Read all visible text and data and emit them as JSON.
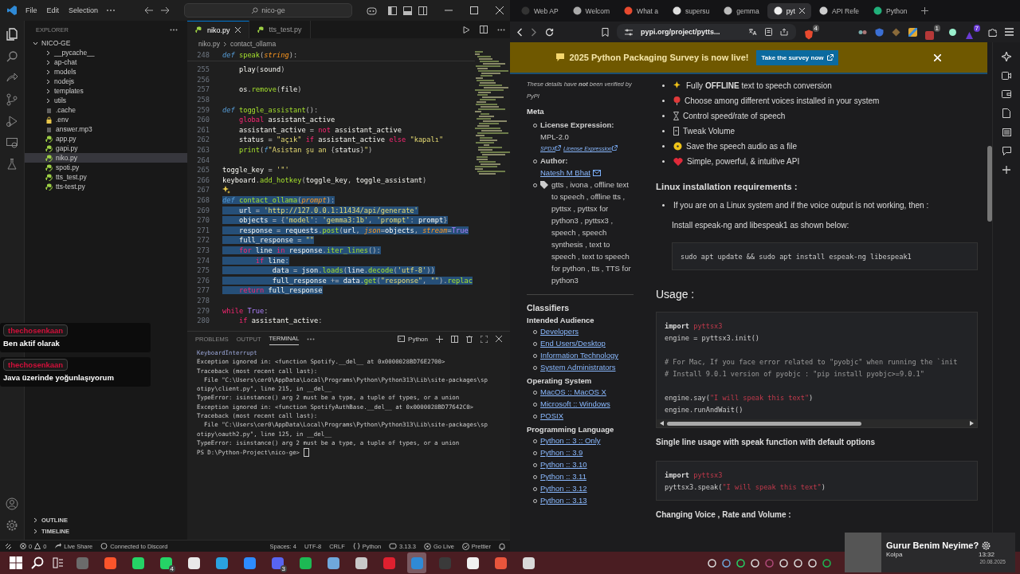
{
  "vscode": {
    "menus": [
      "File",
      "Edit",
      "Selection"
    ],
    "search": "nico-ge",
    "explorer": {
      "title": "EXPLORER",
      "root": {
        "label": "NICO-GE",
        "expanded": true,
        "children": [
          {
            "label": "__pycache__",
            "kind": "folder",
            "expanded": false,
            "selected": false
          },
          {
            "label": "ap-chat",
            "kind": "folder",
            "expanded": false,
            "selected": false
          },
          {
            "label": "models",
            "kind": "folder",
            "expanded": false,
            "selected": false
          },
          {
            "label": "nodejs",
            "kind": "folder",
            "expanded": false,
            "selected": false
          },
          {
            "label": "templates",
            "kind": "folder",
            "expanded": false,
            "selected": false
          },
          {
            "label": "utils",
            "kind": "folder",
            "expanded": false,
            "selected": false
          },
          {
            "label": ".cache",
            "kind": "text",
            "selected": false
          },
          {
            "label": ".env",
            "kind": "env",
            "selected": false
          },
          {
            "label": "answer.mp3",
            "kind": "text",
            "selected": false
          },
          {
            "label": "app.py",
            "kind": "python",
            "selected": false
          },
          {
            "label": "gapi.py",
            "kind": "python",
            "selected": false
          },
          {
            "label": "niko.py",
            "kind": "python",
            "selected": true
          },
          {
            "label": "spoti.py",
            "kind": "python",
            "selected": false
          },
          {
            "label": "tts_test.py",
            "kind": "python",
            "selected": false
          },
          {
            "label": "tts-test.py",
            "kind": "python",
            "selected": false
          }
        ]
      },
      "sections": [
        {
          "label": "OUTLINE",
          "expanded": false
        },
        {
          "label": "TIMELINE",
          "expanded": false
        }
      ]
    },
    "tabs": [
      {
        "label": "niko.py",
        "selected": true
      },
      {
        "label": "tts_test.py",
        "selected": false
      }
    ],
    "breadcrumb": [
      "niko.py",
      "contact_ollama"
    ],
    "sticky": {
      "n": "248",
      "parts": [
        {
          "kind": "k",
          "text": "def "
        },
        {
          "kind": "f",
          "text": "speak"
        },
        {
          "kind": "o",
          "text": "("
        },
        {
          "kind": "p",
          "text": "string"
        },
        {
          "kind": "o",
          "text": "):"
        }
      ]
    },
    "lines": [
      {
        "n": "255",
        "kind": "code",
        "selected": false,
        "parts": [
          {
            "kind": "v",
            "text": "    play"
          },
          {
            "kind": "o",
            "text": "("
          },
          {
            "kind": "v",
            "text": "sound"
          },
          {
            "kind": "o",
            "text": ")"
          }
        ]
      },
      {
        "n": "256",
        "kind": "blank",
        "selected": false
      },
      {
        "n": "257",
        "kind": "code",
        "selected": false,
        "parts": [
          {
            "kind": "v",
            "text": "    os"
          },
          {
            "kind": "o",
            "text": "."
          },
          {
            "kind": "f",
            "text": "remove"
          },
          {
            "kind": "o",
            "text": "("
          },
          {
            "kind": "v",
            "text": "file"
          },
          {
            "kind": "o",
            "text": ")"
          }
        ]
      },
      {
        "n": "258",
        "kind": "blank",
        "selected": false
      },
      {
        "n": "259",
        "kind": "code",
        "selected": false,
        "parts": [
          {
            "kind": "k",
            "text": "def "
          },
          {
            "kind": "f",
            "text": "toggle_assistant"
          },
          {
            "kind": "o",
            "text": "():"
          }
        ]
      },
      {
        "n": "260",
        "kind": "code",
        "selected": false,
        "parts": [
          {
            "kind": "c",
            "text": "    global "
          },
          {
            "kind": "v",
            "text": "assistant_active"
          }
        ]
      },
      {
        "n": "261",
        "kind": "code",
        "selected": false,
        "parts": [
          {
            "kind": "v",
            "text": "    assistant_active "
          },
          {
            "kind": "o",
            "text": "= "
          },
          {
            "kind": "c",
            "text": "not "
          },
          {
            "kind": "v",
            "text": "assistant_active"
          }
        ]
      },
      {
        "n": "262",
        "kind": "code",
        "selected": false,
        "parts": [
          {
            "kind": "v",
            "text": "    status "
          },
          {
            "kind": "o",
            "text": "= "
          },
          {
            "kind": "s",
            "text": "\"açık\" "
          },
          {
            "kind": "c",
            "text": "if "
          },
          {
            "kind": "v",
            "text": "assistant_active "
          },
          {
            "kind": "c",
            "text": "else "
          },
          {
            "kind": "s",
            "text": "\"kapalı\""
          }
        ]
      },
      {
        "n": "263",
        "kind": "code",
        "selected": false,
        "parts": [
          {
            "kind": "f",
            "text": "    print"
          },
          {
            "kind": "o",
            "text": "("
          },
          {
            "kind": "k",
            "text": "f"
          },
          {
            "kind": "s",
            "text": "\"Asistan şu an "
          },
          {
            "kind": "o",
            "text": "{"
          },
          {
            "kind": "v",
            "text": "status"
          },
          {
            "kind": "o",
            "text": "}"
          },
          {
            "kind": "s",
            "text": "\""
          },
          {
            "kind": "o",
            "text": ")"
          }
        ]
      },
      {
        "n": "264",
        "kind": "blank",
        "selected": false
      },
      {
        "n": "265",
        "kind": "code",
        "selected": false,
        "parts": [
          {
            "kind": "v",
            "text": "toggle_key "
          },
          {
            "kind": "o",
            "text": "= "
          },
          {
            "kind": "s",
            "text": "'\"'"
          }
        ]
      },
      {
        "n": "266",
        "kind": "code",
        "selected": false,
        "parts": [
          {
            "kind": "v",
            "text": "keyboard"
          },
          {
            "kind": "o",
            "text": "."
          },
          {
            "kind": "f",
            "text": "add_hotkey"
          },
          {
            "kind": "o",
            "text": "("
          },
          {
            "kind": "v",
            "text": "toggle_key"
          },
          {
            "kind": "o",
            "text": ", "
          },
          {
            "kind": "v",
            "text": "toggle_assistant"
          },
          {
            "kind": "o",
            "text": ")"
          }
        ]
      },
      {
        "n": "267",
        "kind": "hint",
        "selected": false
      },
      {
        "n": "268",
        "kind": "code",
        "selected": true,
        "parts": [
          {
            "kind": "k",
            "text": "def "
          },
          {
            "kind": "f",
            "text": "contact_ollama"
          },
          {
            "kind": "o",
            "text": "("
          },
          {
            "kind": "p",
            "text": "prompt"
          },
          {
            "kind": "o",
            "text": "):"
          }
        ]
      },
      {
        "n": "269",
        "kind": "code",
        "selected": true,
        "parts": [
          {
            "kind": "v",
            "text": "    url "
          },
          {
            "kind": "o",
            "text": "= "
          },
          {
            "kind": "s",
            "text": "'http://127.0.0.1:11434/api/generate'"
          }
        ]
      },
      {
        "n": "270",
        "kind": "code",
        "selected": true,
        "parts": [
          {
            "kind": "v",
            "text": "    objects "
          },
          {
            "kind": "o",
            "text": "= {"
          },
          {
            "kind": "s",
            "text": "'model'"
          },
          {
            "kind": "o",
            "text": ": "
          },
          {
            "kind": "s",
            "text": "'gemma3:1b'"
          },
          {
            "kind": "o",
            "text": ", "
          },
          {
            "kind": "s",
            "text": "'prompt'"
          },
          {
            "kind": "o",
            "text": ": "
          },
          {
            "kind": "v",
            "text": "prompt"
          },
          {
            "kind": "o",
            "text": "}"
          }
        ]
      },
      {
        "n": "271",
        "kind": "code",
        "selected": true,
        "parts": [
          {
            "kind": "v",
            "text": "    response "
          },
          {
            "kind": "o",
            "text": "= "
          },
          {
            "kind": "v",
            "text": "requests"
          },
          {
            "kind": "o",
            "text": "."
          },
          {
            "kind": "f",
            "text": "post"
          },
          {
            "kind": "o",
            "text": "("
          },
          {
            "kind": "v",
            "text": "url"
          },
          {
            "kind": "o",
            "text": ", "
          },
          {
            "kind": "p",
            "text": "json"
          },
          {
            "kind": "o",
            "text": "="
          },
          {
            "kind": "v",
            "text": "objects"
          },
          {
            "kind": "o",
            "text": ", "
          },
          {
            "kind": "p",
            "text": "stream"
          },
          {
            "kind": "o",
            "text": "="
          },
          {
            "kind": "b",
            "text": "True"
          }
        ]
      },
      {
        "n": "272",
        "kind": "code",
        "selected": true,
        "parts": [
          {
            "kind": "v",
            "text": "    full_response "
          },
          {
            "kind": "o",
            "text": "= "
          },
          {
            "kind": "s",
            "text": "\"\""
          }
        ]
      },
      {
        "n": "273",
        "kind": "code",
        "selected": true,
        "parts": [
          {
            "kind": "c",
            "text": "    for "
          },
          {
            "kind": "v",
            "text": "line "
          },
          {
            "kind": "c",
            "text": "in "
          },
          {
            "kind": "v",
            "text": "response"
          },
          {
            "kind": "o",
            "text": "."
          },
          {
            "kind": "f",
            "text": "iter_lines"
          },
          {
            "kind": "o",
            "text": "():"
          }
        ]
      },
      {
        "n": "274",
        "kind": "code",
        "selected": true,
        "parts": [
          {
            "kind": "c",
            "text": "        if "
          },
          {
            "kind": "v",
            "text": "line"
          },
          {
            "kind": "o",
            "text": ":"
          }
        ]
      },
      {
        "n": "275",
        "kind": "code",
        "selected": true,
        "parts": [
          {
            "kind": "v",
            "text": "            data "
          },
          {
            "kind": "o",
            "text": "= "
          },
          {
            "kind": "v",
            "text": "json"
          },
          {
            "kind": "o",
            "text": "."
          },
          {
            "kind": "f",
            "text": "loads"
          },
          {
            "kind": "o",
            "text": "("
          },
          {
            "kind": "v",
            "text": "line"
          },
          {
            "kind": "o",
            "text": "."
          },
          {
            "kind": "f",
            "text": "decode"
          },
          {
            "kind": "o",
            "text": "("
          },
          {
            "kind": "s",
            "text": "'utf-8'"
          },
          {
            "kind": "o",
            "text": "))"
          }
        ]
      },
      {
        "n": "276",
        "kind": "code",
        "selected": true,
        "parts": [
          {
            "kind": "v",
            "text": "            full_response "
          },
          {
            "kind": "o",
            "text": "+= "
          },
          {
            "kind": "v",
            "text": "data"
          },
          {
            "kind": "o",
            "text": "."
          },
          {
            "kind": "f",
            "text": "get"
          },
          {
            "kind": "o",
            "text": "("
          },
          {
            "kind": "s",
            "text": "\"response\""
          },
          {
            "kind": "o",
            "text": ", "
          },
          {
            "kind": "s",
            "text": "\"\""
          },
          {
            "kind": "o",
            "text": ")."
          },
          {
            "kind": "f",
            "text": "replac"
          }
        ]
      },
      {
        "n": "277",
        "kind": "code",
        "selected": true,
        "parts": [
          {
            "kind": "c",
            "text": "    return "
          },
          {
            "kind": "v",
            "text": "full_response"
          }
        ]
      },
      {
        "n": "278",
        "kind": "blank",
        "selected": false
      },
      {
        "n": "279",
        "kind": "code",
        "selected": false,
        "parts": [
          {
            "kind": "c",
            "text": "while "
          },
          {
            "kind": "b",
            "text": "True"
          },
          {
            "kind": "o",
            "text": ":"
          }
        ]
      },
      {
        "n": "280",
        "kind": "code",
        "selected": false,
        "parts": [
          {
            "kind": "c",
            "text": "    if "
          },
          {
            "kind": "v",
            "text": "assistant_active"
          },
          {
            "kind": "o",
            "text": ":"
          }
        ]
      }
    ],
    "panel": {
      "tabs": [
        {
          "label": "PROBLEMS",
          "selected": false
        },
        {
          "label": "OUTPUT",
          "selected": false
        },
        {
          "label": "TERMINAL",
          "selected": true
        }
      ],
      "shell": "Python",
      "lines": [
        "KeyboardInterrupt",
        "Exception ignored in: <function Spotify.__del__ at 0x0000028BD76E2700>",
        "Traceback (most recent call last):",
        "  File \"C:\\Users\\cer0\\AppData\\Local\\Programs\\Python\\Python313\\Lib\\site-packages\\sp",
        "otipy\\client.py\", line 215, in __del__",
        "TypeError: isinstance() arg 2 must be a type, a tuple of types, or a union",
        "Exception ignored in: <function SpotifyAuthBase.__del__ at 0x0000028BD77642C0>",
        "Traceback (most recent call last):",
        "  File \"C:\\Users\\cer0\\AppData\\Local\\Programs\\Python\\Python313\\Lib\\site-packages\\sp",
        "otipy\\oauth2.py\", line 125, in __del__",
        "TypeError: isinstance() arg 2 must be a type, a tuple of types, or a union"
      ],
      "prompt": "PS D:\\Python-Project\\nico-ge>"
    },
    "status": {
      "errors": "0",
      "warnings": "0",
      "left": [
        {
          "kind": "liveshare",
          "label": "Live Share"
        },
        {
          "kind": "discord",
          "label": "Connected to Discord"
        }
      ],
      "right": [
        {
          "kind": "text",
          "label": "Spaces: 4"
        },
        {
          "kind": "text",
          "label": "UTF-8"
        },
        {
          "kind": "text",
          "label": "CRLF"
        },
        {
          "kind": "language",
          "label": "Python"
        },
        {
          "kind": "version",
          "label": "3.13.3"
        },
        {
          "kind": "golive",
          "label": "Go Live"
        },
        {
          "kind": "prettier",
          "label": "Prettier"
        }
      ]
    }
  },
  "browser": {
    "tabs": [
      {
        "label": "Web AP",
        "selected": false
      },
      {
        "label": "Welcom",
        "selected": false
      },
      {
        "label": "What a",
        "selected": false
      },
      {
        "label": "supersu",
        "selected": false
      },
      {
        "label": "gemma",
        "selected": false
      },
      {
        "label": "pyt",
        "selected": true
      },
      {
        "label": "API Refe",
        "selected": false
      },
      {
        "label": "Python",
        "selected": false
      }
    ],
    "address": "pypi.org/project/pytts...",
    "shield_count": "4",
    "ext_badges": [
      "1",
      "7"
    ],
    "banner": {
      "text": "2025 Python Packaging Survey is now live!",
      "button": "Take the survey now"
    },
    "side": {
      "note": "These details have **not** been verified by PyPI",
      "meta_title": "Meta",
      "meta": [
        {
          "kind": "license",
          "label": "License Expression:",
          "value": "MPL-2.0",
          "links": [
            "SPDX",
            "License Expression"
          ]
        },
        {
          "kind": "author",
          "label": "Author:",
          "link": "Natesh M Bhat"
        },
        {
          "kind": "keywords",
          "text": "gtts , ivona , offline text to speech , offline tts , pyttsx , pyttsx for python3 , pyttsx3 , speech , speech synthesis , text to speech , text to speech for python , tts , TTS for python3"
        }
      ],
      "classifiers_title": "Classifiers",
      "groups": [
        {
          "title": "Intended Audience",
          "links": [
            "Developers",
            "End Users/Desktop",
            "Information Technology",
            "System Administrators"
          ]
        },
        {
          "title": "Operating System",
          "links": [
            "MacOS :: MacOS X",
            "Microsoft :: Windows",
            "POSIX"
          ]
        },
        {
          "title": "Programming Language",
          "links": [
            "Python :: 3 :: Only",
            "Python :: 3.9",
            "Python :: 3.10",
            "Python :: 3.11",
            "Python :: 3.12",
            "Python :: 3.13"
          ]
        }
      ]
    },
    "blocks": [
      {
        "kind": "features",
        "items": [
          "Fully **OFFLINE** text to speech conversion",
          "Choose among different voices installed in your system",
          "Control speed/rate of speech",
          "Tweak Volume",
          "Save the speech audio as a file",
          "Simple, powerful, & intuitive API"
        ]
      },
      {
        "kind": "heading",
        "text": "Linux installation requirements :"
      },
      {
        "kind": "bullet",
        "text": "If you are on a Linux system and if the voice output is not working, then :"
      },
      {
        "kind": "para",
        "text": "Install espeak-ng and libespeak1 as shown below:"
      },
      {
        "kind": "code",
        "scrollbar": false,
        "lines": [
          {
            "kind": "code",
            "parts": [
              {
                "kind": "t",
                "text": "sudo apt update && sudo apt install espeak-ng libespeak1"
              }
            ]
          }
        ]
      },
      {
        "kind": "title",
        "text": "Usage :"
      },
      {
        "kind": "code",
        "scrollbar": true,
        "lines": [
          {
            "kind": "code",
            "parts": [
              {
                "kind": "k",
                "text": "import "
              },
              {
                "kind": "m",
                "text": "pyttsx3"
              }
            ]
          },
          {
            "kind": "code",
            "parts": [
              {
                "kind": "t",
                "text": "engine = pyttsx3.init()"
              }
            ]
          },
          {
            "kind": "blank"
          },
          {
            "kind": "code",
            "parts": [
              {
                "kind": "c",
                "text": "# For Mac, If you face error related to \"pyobjc\" when running the `init"
              }
            ]
          },
          {
            "kind": "code",
            "parts": [
              {
                "kind": "c",
                "text": "# Install 9.0.1 version of pyobjc : \"pip install pyobjc>=9.0.1\""
              }
            ]
          },
          {
            "kind": "blank"
          },
          {
            "kind": "code",
            "parts": [
              {
                "kind": "t",
                "text": "engine.say("
              },
              {
                "kind": "s",
                "text": "\"I will speak this text\""
              },
              {
                "kind": "t",
                "text": ")"
              }
            ]
          },
          {
            "kind": "code",
            "parts": [
              {
                "kind": "t",
                "text": "engine.runAndWait()"
              }
            ]
          }
        ]
      },
      {
        "kind": "subheading",
        "text": "Single line usage with speak function with default options"
      },
      {
        "kind": "code",
        "scrollbar": false,
        "lines": [
          {
            "kind": "code",
            "parts": [
              {
                "kind": "k",
                "text": "import "
              },
              {
                "kind": "m",
                "text": "pyttsx3"
              }
            ]
          },
          {
            "kind": "code",
            "parts": [
              {
                "kind": "t",
                "text": "pyttsx3.speak("
              },
              {
                "kind": "s",
                "text": "\"I will speak this text\""
              },
              {
                "kind": "t",
                "text": ")"
              }
            ]
          }
        ]
      },
      {
        "kind": "subheading",
        "text": "Changing Voice , Rate and Volume :"
      }
    ]
  },
  "chat": [
    {
      "user": "thechosenkaan",
      "message": "Ben aktif olarak"
    },
    {
      "user": "thechosenkaan",
      "message": "Java üzerinde yoğunlaşıyorum"
    }
  ],
  "taskbar": {
    "apps": [
      {
        "color": "#6b6b6b",
        "selected": false
      },
      {
        "color": "#fb542b",
        "selected": false
      },
      {
        "color": "#25d366",
        "selected": false
      },
      {
        "color": "#25d366",
        "selected": false,
        "badge": "4"
      },
      {
        "color": "#e9e9e9",
        "selected": false
      },
      {
        "color": "#2aa3e0",
        "selected": false
      },
      {
        "color": "#2d8cff",
        "selected": false
      },
      {
        "color": "#5865f2",
        "selected": false,
        "badge": "3"
      },
      {
        "color": "#1db954",
        "selected": false
      },
      {
        "color": "#6fa8dc",
        "selected": false
      },
      {
        "color": "#c9c9c9",
        "selected": false
      },
      {
        "color": "#e0202f",
        "selected": false
      },
      {
        "color": "#2f8ad6",
        "selected": true
      },
      {
        "color": "#3a3a3a",
        "selected": false
      },
      {
        "color": "#f0f0f0",
        "selected": false
      },
      {
        "color": "#e8553c",
        "selected": false
      },
      {
        "color": "#d9d9d9",
        "selected": false
      }
    ]
  },
  "media": {
    "title": "Gurur Benim Neyime?",
    "artist": "Kolpa",
    "time": "13:32",
    "date": "20.08.2025"
  }
}
